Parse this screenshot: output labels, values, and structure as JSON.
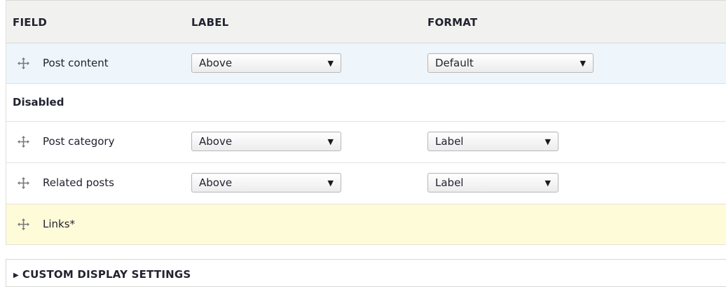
{
  "table": {
    "headers": {
      "field": "FIELD",
      "label": "LABEL",
      "format": "FORMAT"
    },
    "rows": [
      {
        "name": "Post content",
        "label_select": "Above",
        "format_select": "Default"
      }
    ],
    "disabled_region": {
      "title": "Disabled",
      "rows": [
        {
          "name": "Post category",
          "label_select": "Above",
          "format_select": "Label"
        },
        {
          "name": "Related posts",
          "label_select": "Above",
          "format_select": "Label"
        },
        {
          "name": "Links*"
        }
      ]
    }
  },
  "custom_display": {
    "summary": "CUSTOM DISPLAY SETTINGS",
    "toggle_icon": "triangle-right"
  },
  "colors": {
    "header_bg": "#f1f1f0",
    "drag_highlight_bg": "#eef5fb",
    "changed_row_bg": "#fefbd8"
  },
  "icons": {
    "drag_handle": "move-arrows-icon",
    "select_caret": "triangle-down"
  }
}
